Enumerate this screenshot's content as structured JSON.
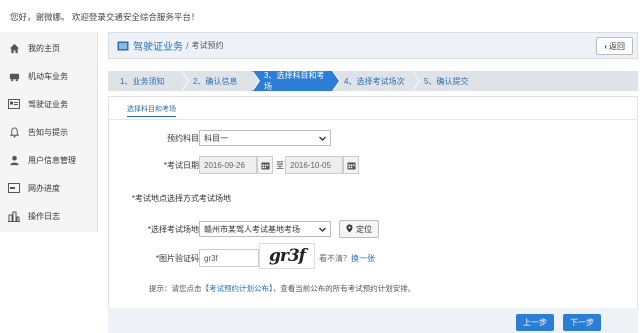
{
  "header": {
    "welcome": "您好，谢微娜。 欢迎登录交通安全综合服务平台！"
  },
  "sidebar": {
    "items": [
      {
        "label": "我的主页",
        "icon": "home-icon"
      },
      {
        "label": "机动车业务",
        "icon": "car-icon"
      },
      {
        "label": "驾驶证业务",
        "icon": "license-card-icon"
      },
      {
        "label": "告知与提示",
        "icon": "bell-icon"
      },
      {
        "label": "用户信息管理",
        "icon": "user-icon"
      },
      {
        "label": "网办进度",
        "icon": "progress-icon"
      },
      {
        "label": "操作日志",
        "icon": "log-icon"
      }
    ]
  },
  "titlebar": {
    "main": "驾驶证业务",
    "separator": "/",
    "sub": "考试预约",
    "back": "返回"
  },
  "steps": [
    {
      "label": "1、业务须知",
      "state": "done"
    },
    {
      "label": "2、确认信息",
      "state": "done"
    },
    {
      "label": "3、选择科目和考场",
      "state": "active"
    },
    {
      "label": "4、选择考试场次",
      "state": "todo"
    },
    {
      "label": "5、确认提交",
      "state": "todo"
    }
  ],
  "panel": {
    "tab": "选择科目和考场"
  },
  "form": {
    "subject": {
      "label": "预约科目",
      "value": "科目一"
    },
    "date": {
      "label": "*考试日期",
      "from": "2016-09-26",
      "to": "2016-10-05",
      "sep": "至"
    },
    "method": {
      "label": "*考试地点选择方式",
      "value": "考试场地"
    },
    "venue": {
      "label": "*选择考试场地",
      "value": "赣州市某驾人考试基地考场",
      "locate": "定位"
    },
    "captcha": {
      "label": "*图片验证码",
      "value": "gr3f",
      "image_text": "gr3f",
      "help_prefix": "看不清？",
      "help_link": "换一张"
    },
    "tip": {
      "prefix": "提示：请您点击",
      "link": "【考试预约计划公布】",
      "suffix": "，查看当前公布的所有考试预约计划安排。"
    }
  },
  "buttons": {
    "prev": "上一步",
    "next": "下一步"
  },
  "colors": {
    "accent": "#2c7dd5",
    "link": "#2a6fb5",
    "step_bar": "#dfe3e7"
  }
}
